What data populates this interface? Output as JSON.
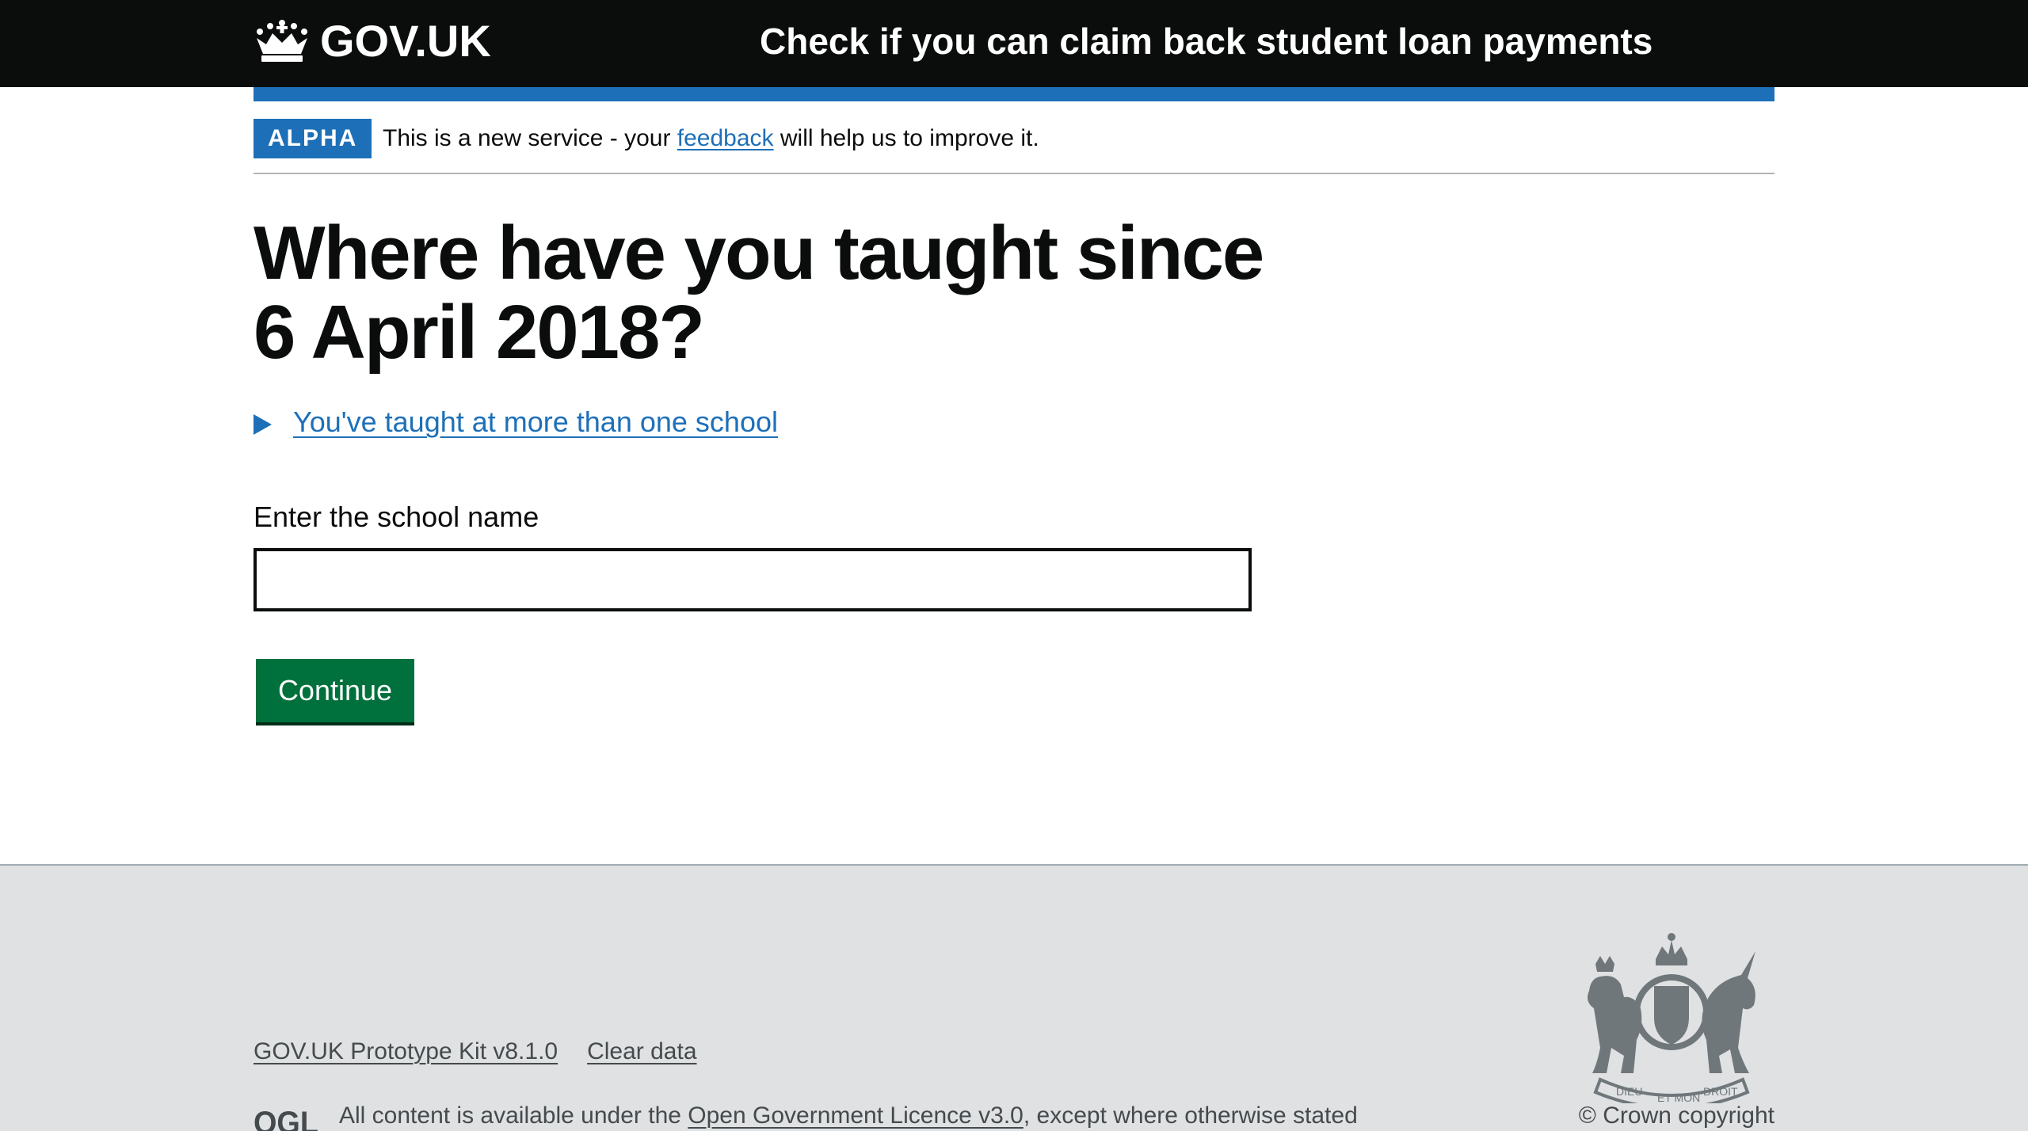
{
  "header": {
    "logo_text": "GOV.UK",
    "service_name": "Check if you can claim back student loan payments"
  },
  "phase_banner": {
    "tag": "ALPHA",
    "text_before": "This is a new service - your ",
    "link_text": "feedback",
    "text_after": " will help us to improve it."
  },
  "main": {
    "heading": "Where have you taught since 6 April 2018?",
    "details_summary": "You've taught at more than one school",
    "input_label": "Enter the school name",
    "input_value": "",
    "continue_label": "Continue"
  },
  "footer": {
    "links": [
      "GOV.UK Prototype Kit v8.1.0",
      "Clear data"
    ],
    "ogl_text": "OGL",
    "licence_prefix": "All content is available under the ",
    "licence_link": "Open Government Licence v3.0",
    "licence_suffix": ", except where otherwise stated",
    "crest_mottos": [
      "DIEU",
      "ET MON",
      "DROIT"
    ],
    "copyright": "© Crown copyright"
  },
  "colors": {
    "header_bg": "#0b0c0c",
    "brand_blue": "#1d70b8",
    "button_green": "#00703c",
    "footer_bg": "#dfe1e3",
    "footer_text": "#454a4c"
  }
}
